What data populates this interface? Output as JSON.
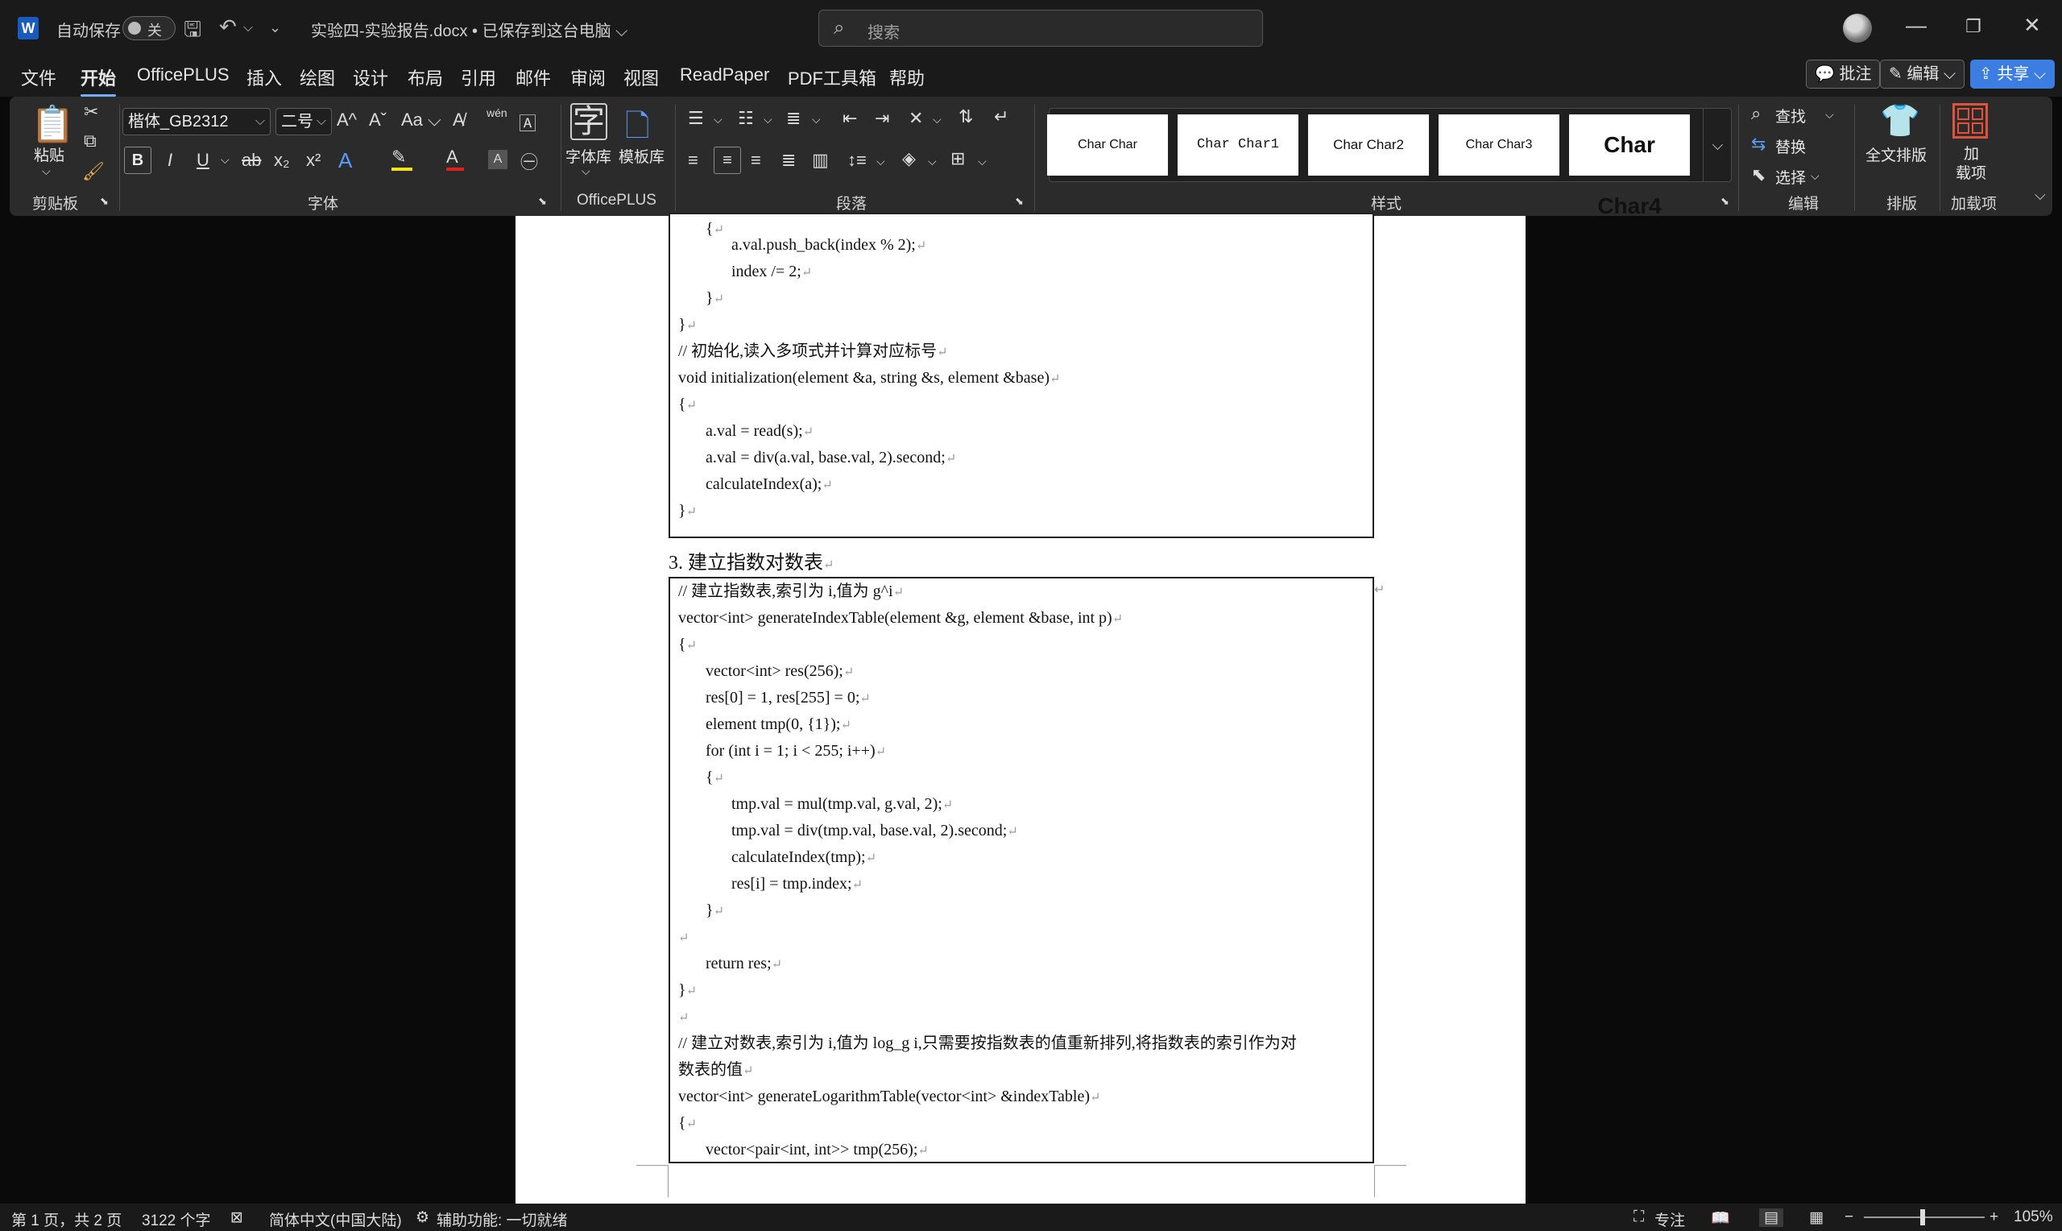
{
  "titlebar": {
    "app_icon": "W",
    "autosave_label": "自动保存",
    "autosave_state": "关",
    "document_title": "实验四-实验报告.docx • 已保存到这台电脑 ⌵",
    "search_placeholder": "搜索",
    "icons": [
      "save-icon",
      "undo-icon",
      "customize-icon",
      "minimize-icon",
      "restore-icon",
      "close-icon"
    ]
  },
  "menu": {
    "items": [
      "文件",
      "开始",
      "OfficePLUS",
      "插入",
      "绘图",
      "设计",
      "布局",
      "引用",
      "邮件",
      "审阅",
      "视图",
      "ReadPaper",
      "PDF工具箱",
      "帮助"
    ],
    "active": "开始",
    "comment_btn": "批注",
    "edit_btn": "编辑",
    "share_btn": "共享"
  },
  "ribbon": {
    "clipboard": {
      "paste": "粘贴",
      "label": "剪贴板"
    },
    "font": {
      "family": "楷体_GB2312",
      "size": "二号",
      "label": "字体",
      "buttons": [
        "B",
        "I",
        "U",
        "ab",
        "x₂",
        "x²",
        "A"
      ],
      "increase": "A^",
      "decrease": "Aˇ",
      "case": "Aa",
      "pinyin": "wén"
    },
    "officeplus": {
      "fontlib": "字体库",
      "templates": "模板库",
      "label": "OfficePLUS"
    },
    "paragraph": {
      "label": "段落"
    },
    "styles": {
      "label": "样式",
      "cards": [
        "Char Char",
        "Char Char1",
        "Char Char2",
        "Char Char3",
        "Char Char4"
      ]
    },
    "editing": {
      "find": "查找",
      "replace": "替换",
      "select": "选择",
      "label": "编辑"
    },
    "layout": {
      "full": "全文排版",
      "label": "排版"
    },
    "addins": {
      "line1": "加",
      "line2": "载项",
      "label": "加载项"
    }
  },
  "document": {
    "box1_lines": [
      "{",
      "a.val.push_back(index % 2);",
      "index /= 2;",
      "}",
      "}",
      "// 初始化,读入多项式并计算对应标号",
      "void initialization(element &a, string &s, element &base)",
      "{",
      "a.val = read(s);",
      "a.val = div(a.val, base.val, 2).second;",
      "calculateIndex(a);",
      "}"
    ],
    "heading": "3. 建立指数对数表",
    "box2_lines": [
      "// 建立指数表,索引为 i,值为 g^i",
      "vector<int> generateIndexTable(element &g, element &base, int p)",
      "{",
      "vector<int> res(256);",
      "res[0] = 1, res[255] = 0;",
      "element tmp(0, {1});",
      "for (int i = 1; i < 255; i++)",
      "{",
      "tmp.val = mul(tmp.val, g.val, 2);",
      "tmp.val = div(tmp.val, base.val, 2).second;",
      "calculateIndex(tmp);",
      "res[i] = tmp.index;",
      "}",
      "",
      "return res;",
      "}",
      "",
      "// 建立对数表,索引为 i,值为 log_g i,只需要按指数表的值重新排列,将指数表的索引作为对",
      "数表的值",
      "vector<int> generateLogarithmTable(vector<int> &indexTable)",
      "{",
      "vector<pair<int, int>> tmp(256);"
    ]
  },
  "status": {
    "page": "第 1 页，共 2 页",
    "words": "3122 个字",
    "language": "简体中文(中国大陆)",
    "accessibility": "辅助功能: 一切就绪",
    "focus": "专注",
    "zoom": "105%"
  }
}
